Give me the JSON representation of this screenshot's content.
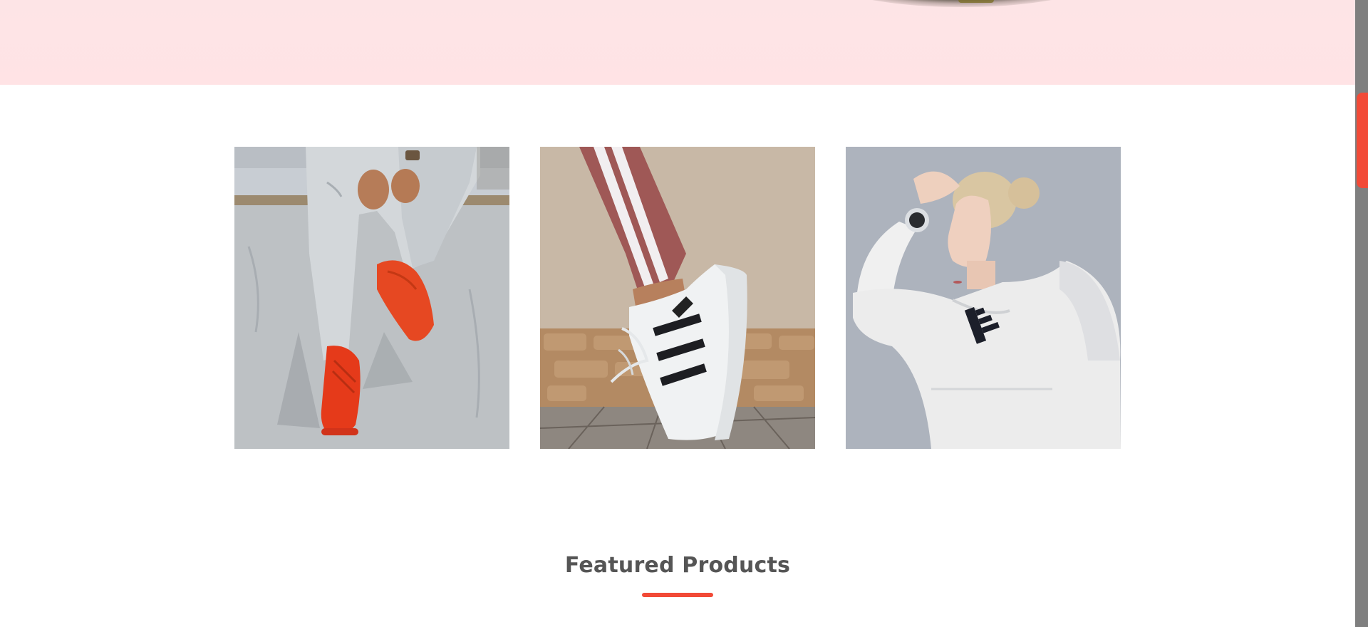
{
  "page": {
    "accent_color": "#f24a37",
    "banner_color": "#fde4e6"
  },
  "hero": {
    "image": "sneaker-on-pink-background"
  },
  "gallery": {
    "tiles": [
      {
        "image": "person-wearing-red-sneakers-sitting-on-ledge"
      },
      {
        "image": "white-striped-sneaker-on-tiptoe"
      },
      {
        "image": "woman-in-white-hoodie-with-watch"
      }
    ]
  },
  "featured": {
    "title": "Featured Products"
  }
}
